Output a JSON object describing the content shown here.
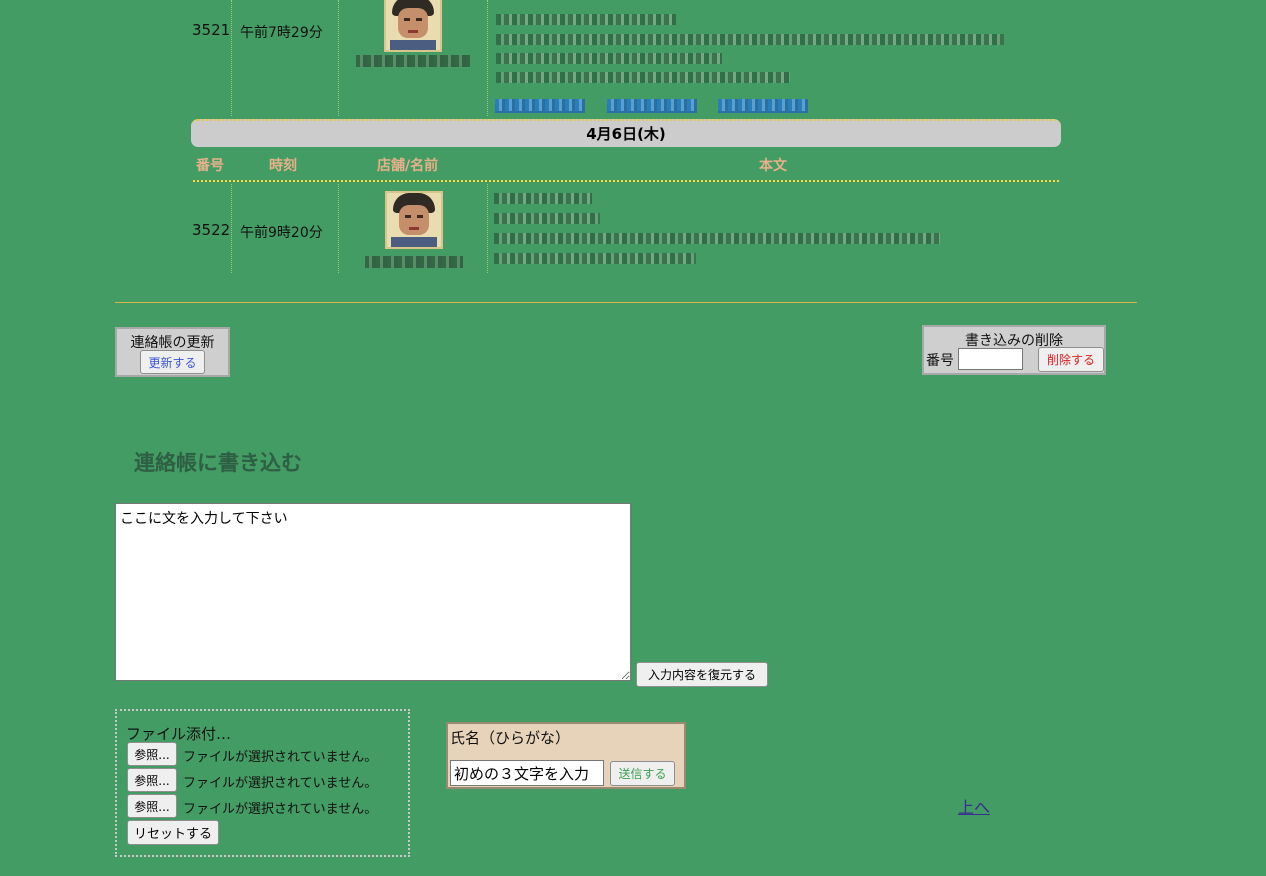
{
  "messages": [
    {
      "number": "3521",
      "time": "午前7時29分"
    },
    {
      "number": "3522",
      "time": "午前9時20分"
    }
  ],
  "date_band": "4月6日(木)",
  "table_headers": {
    "number": "番号",
    "time": "時刻",
    "store_name": "店舗/名前",
    "body": "本文"
  },
  "update_box": {
    "title": "連絡帳の更新",
    "button": "更新する"
  },
  "delete_box": {
    "title": "書き込みの削除",
    "number_label": "番号",
    "number_value": "",
    "button": "削除する"
  },
  "compose": {
    "heading": "連絡帳に書き込む",
    "textarea_value": "ここに文を入力して下さい",
    "restore_button": "入力内容を復元する"
  },
  "attachments": {
    "title": "ファイル添付…",
    "files": [
      {
        "button": "参照...",
        "status": "ファイルが選択されていません。"
      },
      {
        "button": "参照...",
        "status": "ファイルが選択されていません。"
      },
      {
        "button": "参照...",
        "status": "ファイルが選択されていません。"
      }
    ],
    "reset_button": "リセットする"
  },
  "name_box": {
    "label": "氏名（ひらがな）",
    "input_value": "初めの３文字を入力",
    "submit_button": "送信する"
  },
  "to_top_link": "上へ",
  "colors": {
    "background": "#439c63",
    "delete_accent": "#e02020",
    "update_accent": "#3a56d8",
    "submit_accent": "#3aa050"
  }
}
